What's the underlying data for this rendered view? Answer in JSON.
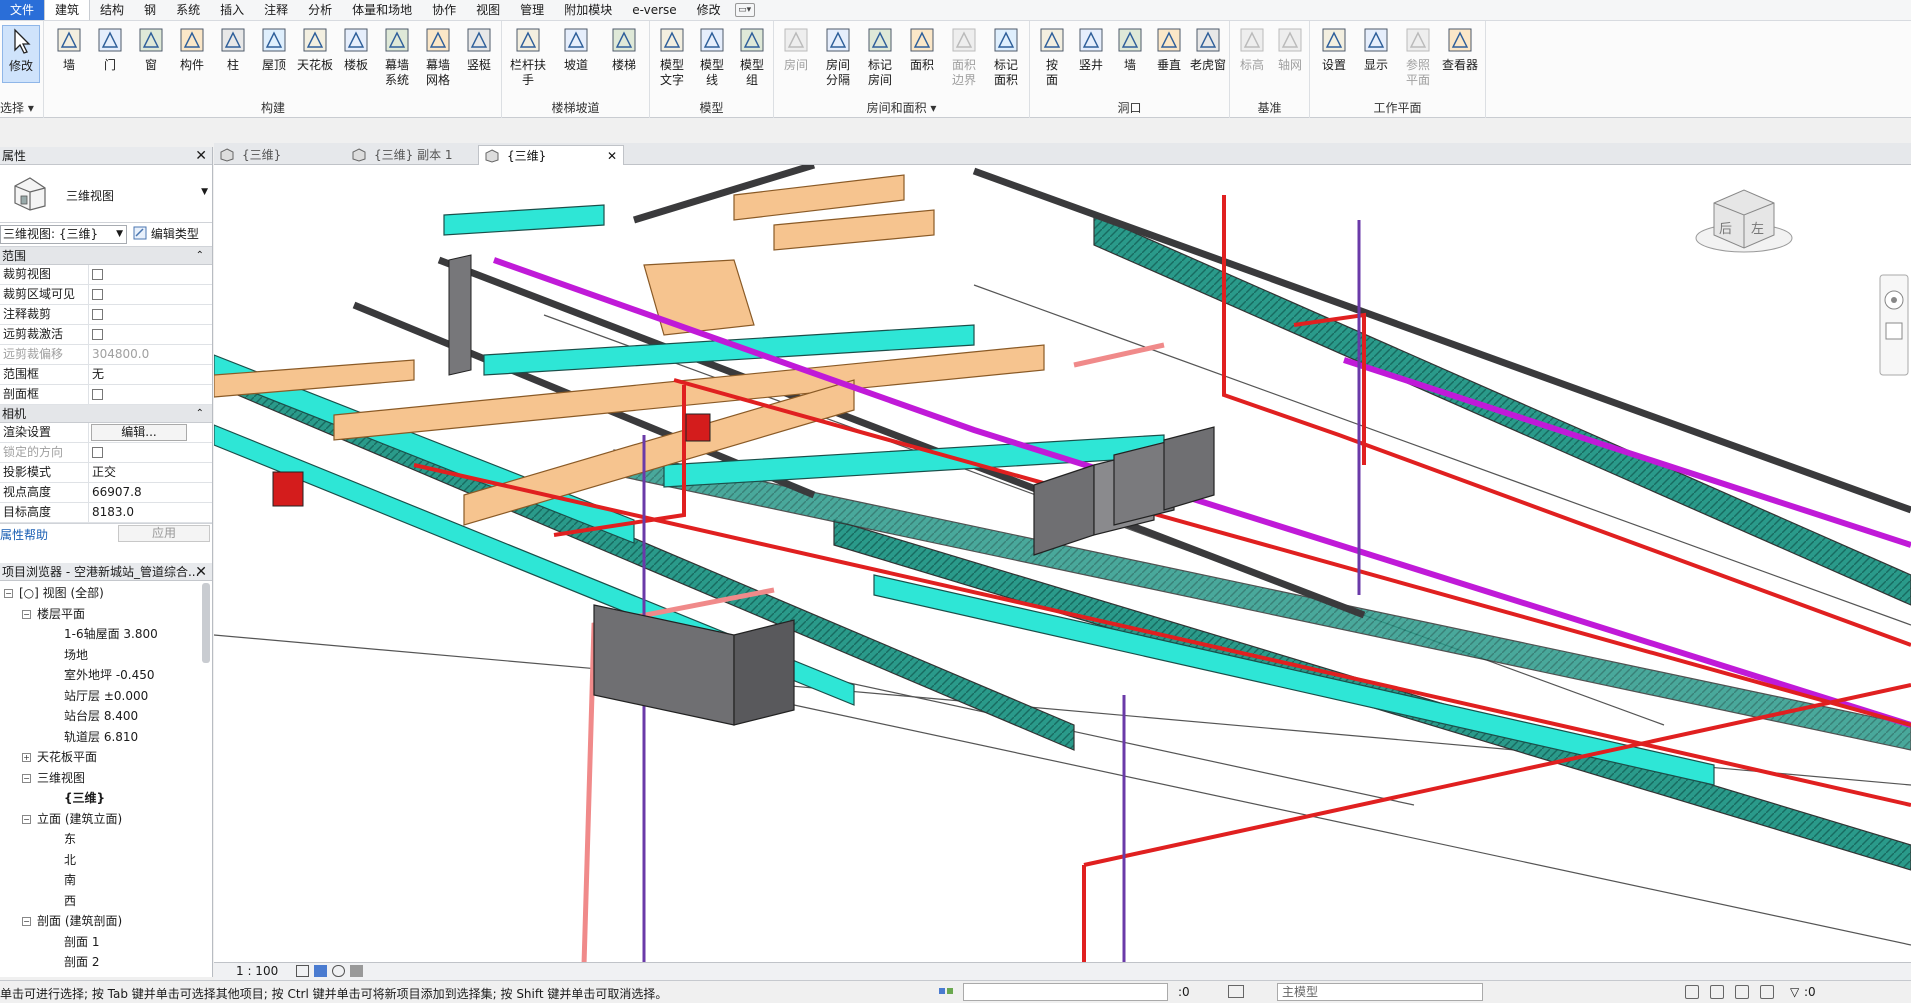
{
  "menubar": {
    "tabs": [
      "文件",
      "建筑",
      "结构",
      "钢",
      "系统",
      "插入",
      "注释",
      "分析",
      "体量和场地",
      "协作",
      "视图",
      "管理",
      "附加模块",
      "e-verse",
      "修改"
    ],
    "active_tab": "建筑"
  },
  "ribbon": {
    "select": {
      "modify": "修改",
      "select_label": "选择"
    },
    "build": {
      "title": "构建",
      "buttons": [
        "墙",
        "门",
        "窗",
        "构件",
        "柱",
        "屋顶",
        "天花板",
        "楼板",
        "幕墙\n系统",
        "幕墙\n网格",
        "竖梃"
      ]
    },
    "stairs": {
      "title": "楼梯坡道",
      "buttons": [
        "栏杆扶手",
        "坡道",
        "楼梯"
      ]
    },
    "model": {
      "title": "模型",
      "buttons": [
        "模型\n文字",
        "模型\n线",
        "模型\n组"
      ]
    },
    "room": {
      "title": "房间和面积",
      "buttons": [
        "房间",
        "房间\n分隔",
        "标记\n房间",
        "面积",
        "面积\n边界",
        "标记\n面积"
      ]
    },
    "opening": {
      "title": "洞口",
      "buttons": [
        "按\n面",
        "竖井",
        "墙",
        "垂直",
        "老虎窗"
      ]
    },
    "datum": {
      "title": "基准",
      "buttons": [
        "标高",
        "轴网"
      ]
    },
    "workplane": {
      "title": "工作平面",
      "buttons": [
        "设置",
        "显示",
        "参照\n平面",
        "查看器"
      ]
    }
  },
  "properties": {
    "title": "属性",
    "type_name": "三维视图",
    "view_selector": "三维视图: {三维}",
    "edit_type": "编辑类型",
    "sections": [
      {
        "name": "范围",
        "rows": [
          {
            "key": "裁剪视图",
            "value": "",
            "check": true,
            "dim": false
          },
          {
            "key": "裁剪区域可见",
            "value": "",
            "check": true,
            "dim": false
          },
          {
            "key": "注释裁剪",
            "value": "",
            "check": true,
            "dim": false
          },
          {
            "key": "远剪裁激活",
            "value": "",
            "check": true,
            "dim": false
          },
          {
            "key": "远剪裁偏移",
            "value": "304800.0",
            "check": false,
            "dim": true
          },
          {
            "key": "范围框",
            "value": "无",
            "check": false,
            "dim": false
          },
          {
            "key": "剖面框",
            "value": "",
            "check": true,
            "dim": false
          }
        ]
      },
      {
        "name": "相机",
        "rows": [
          {
            "key": "渲染设置",
            "value": "编辑...",
            "button": true,
            "dim": false
          },
          {
            "key": "锁定的方向",
            "value": "",
            "check": true,
            "dim": true
          },
          {
            "key": "投影模式",
            "value": "正交",
            "check": false,
            "dim": false
          },
          {
            "key": "视点高度",
            "value": "66907.8",
            "check": false,
            "dim": false
          },
          {
            "key": "目标高度",
            "value": "8183.0",
            "check": false,
            "dim": false
          }
        ]
      }
    ],
    "help_link": "属性帮助",
    "apply": "应用"
  },
  "browser": {
    "title": "项目浏览器 - 空港新城站_管道综合...",
    "nodes": [
      {
        "label": "视图 (全部)",
        "depth": 0,
        "pm": "-",
        "icon": true
      },
      {
        "label": "楼层平面",
        "depth": 1,
        "pm": "-"
      },
      {
        "label": "1-6轴屋面 3.800",
        "depth": 2
      },
      {
        "label": "场地",
        "depth": 2
      },
      {
        "label": "室外地坪 -0.450",
        "depth": 2
      },
      {
        "label": "站厅层 ±0.000",
        "depth": 2
      },
      {
        "label": "站台层 8.400",
        "depth": 2
      },
      {
        "label": "轨道层 6.810",
        "depth": 2
      },
      {
        "label": "天花板平面",
        "depth": 1,
        "pm": "+"
      },
      {
        "label": "三维视图",
        "depth": 1,
        "pm": "-"
      },
      {
        "label": "{三维}",
        "depth": 2,
        "selected": true
      },
      {
        "label": "立面 (建筑立面)",
        "depth": 1,
        "pm": "-"
      },
      {
        "label": "东",
        "depth": 2
      },
      {
        "label": "北",
        "depth": 2
      },
      {
        "label": "南",
        "depth": 2
      },
      {
        "label": "西",
        "depth": 2
      },
      {
        "label": "剖面 (建筑剖面)",
        "depth": 1,
        "pm": "-"
      },
      {
        "label": "剖面 1",
        "depth": 2
      },
      {
        "label": "剖面 2",
        "depth": 2
      }
    ]
  },
  "view_tabs": [
    "{三维}",
    "{三维} 副本 1",
    "{三维}"
  ],
  "viewcube": {
    "back": "后",
    "left": "左"
  },
  "view_control": {
    "scale": "1 : 100"
  },
  "status": {
    "message": "单击可进行选择; 按 Tab 键并单击可选择其他项目; 按 Ctrl 键并单击可将新项目添加到选择集; 按 Shift 键并单击可取消选择。",
    "workset_count": ":0",
    "model": "主模型",
    "filter_count": ":0"
  },
  "colors": {
    "file_tab": "#2a6ed8",
    "duct_cyan": "#2ee6d6",
    "duct_orange": "#f6c48f",
    "pipe_red": "#e02020",
    "pipe_pink": "#f08a8a",
    "pipe_magenta": "#c01ad8",
    "tray_teal": "#1f8f80",
    "equipment_gray": "#6f6f72"
  }
}
